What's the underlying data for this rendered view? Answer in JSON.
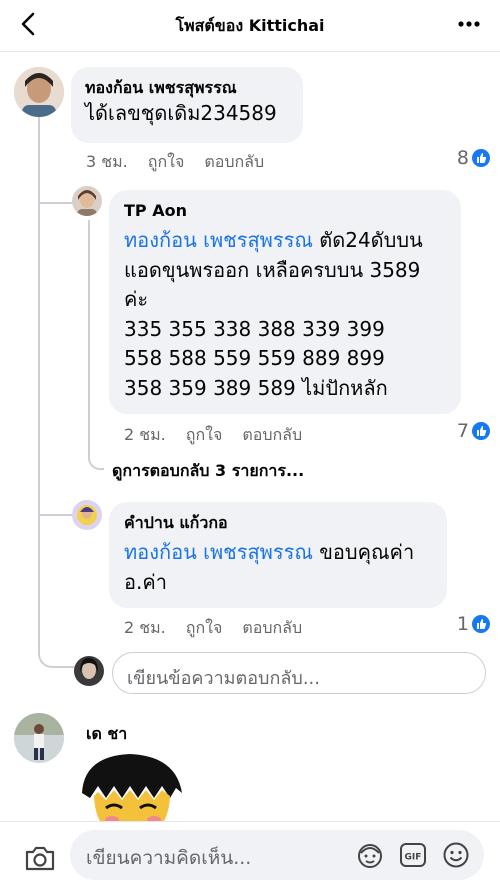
{
  "header": {
    "title": "โพสต์ของ Kittichai"
  },
  "comments": [
    {
      "author": "ทองก้อน เพชรสุพรรณ",
      "text": "ได้เลขชุดเดิม234589",
      "time": "3 ชม.",
      "like_label": "ถูกใจ",
      "reply_label": "ตอบกลับ",
      "reaction_count": "8"
    },
    {
      "author": "TP Aon",
      "mention": "ทองก้อน เพชรสุพรรณ",
      "lines": [
        " ตัด24ดับบน",
        "แอดขุนพรออก เหลือครบบน 3589",
        "ค่ะ",
        "335 355 338 388 339 399",
        "558 588 559 559 889 899",
        "358 359 389 589 ไม่ปักหลัก"
      ],
      "time": "2 ชม.",
      "like_label": "ถูกใจ",
      "reply_label": "ตอบกลับ",
      "reaction_count": "7"
    },
    {
      "author": "คำปาน แก้วกอ",
      "mention": "ทองก้อน เพชรสุพรรณ",
      "line1_rest": " ขอบคุณค่า",
      "line2": "อ.ค่า",
      "time": "2 ชม.",
      "like_label": "ถูกใจ",
      "reply_label": "ตอบกลับ",
      "reaction_count": "1"
    },
    {
      "author": "เด ชา"
    }
  ],
  "more_replies": "ดูการตอบกลับ 3 รายการ...",
  "reply_input": {
    "placeholder": "เขียนข้อความตอบกลับ..."
  },
  "composer": {
    "placeholder": "เขียนความคิดเห็น..."
  },
  "colors": {
    "accent": "#1877f2",
    "mention": "#1b74e4",
    "bubble": "#f0f2f5",
    "muted": "#65676b"
  },
  "icons": [
    "back-arrow-icon",
    "more-dots-icon",
    "like-icon",
    "camera-icon",
    "avatar-sticker-icon",
    "gif-icon",
    "smiley-icon"
  ]
}
